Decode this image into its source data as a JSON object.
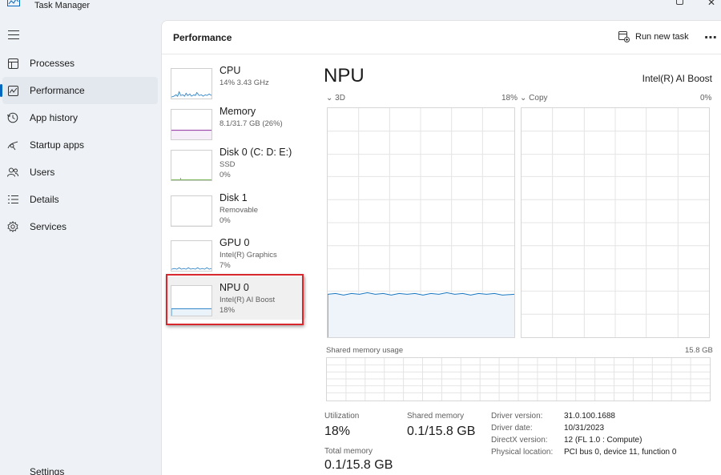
{
  "app": {
    "title": "Task Manager"
  },
  "nav": {
    "items": [
      {
        "label": "Processes",
        "icon": "processes-icon"
      },
      {
        "label": "Performance",
        "icon": "performance-icon",
        "active": true
      },
      {
        "label": "App history",
        "icon": "app-history-icon"
      },
      {
        "label": "Startup apps",
        "icon": "startup-apps-icon"
      },
      {
        "label": "Users",
        "icon": "users-icon"
      },
      {
        "label": "Details",
        "icon": "details-icon"
      },
      {
        "label": "Services",
        "icon": "services-icon"
      }
    ],
    "settings_label": "Settings"
  },
  "header": {
    "title": "Performance",
    "run_task_label": "Run new task",
    "more_label": "⋯"
  },
  "devices": [
    {
      "name": "CPU",
      "sub1": "14%  3.43 GHz",
      "sub2": "",
      "color": "#1a78c2"
    },
    {
      "name": "Memory",
      "sub1": "8.1/31.7 GB (26%)",
      "sub2": "",
      "color": "#8b2c9e"
    },
    {
      "name": "Disk 0 (C: D: E:)",
      "sub1": "SSD",
      "sub2": "0%",
      "color": "#4d9a1f"
    },
    {
      "name": "Disk 1",
      "sub1": "Removable",
      "sub2": "0%",
      "color": "#4d9a1f"
    },
    {
      "name": "GPU 0",
      "sub1": "Intel(R) Graphics",
      "sub2": "7%",
      "color": "#1a78c2"
    },
    {
      "name": "NPU 0",
      "sub1": "Intel(R) AI Boost",
      "sub2": "18%",
      "color": "#1a78c2",
      "selected": true
    }
  ],
  "detail": {
    "title": "NPU",
    "device_name": "Intel(R) AI Boost",
    "graph1": {
      "label": "3D",
      "value": "18%",
      "level": 0.18
    },
    "graph2": {
      "label": "Copy",
      "value": "0%",
      "level": 0
    },
    "shared_memory": {
      "label": "Shared memory usage",
      "value": "15.8 GB"
    },
    "stats": {
      "utilization_label": "Utilization",
      "utilization_value": "18%",
      "shared_label": "Shared memory",
      "shared_value": "0.1/15.8 GB",
      "total_label": "Total memory",
      "total_value": "0.1/15.8 GB"
    },
    "info": {
      "driver_version_label": "Driver version:",
      "driver_version": "31.0.100.1688",
      "driver_date_label": "Driver date:",
      "driver_date": "10/31/2023",
      "directx_label": "DirectX version:",
      "directx": "12 (FL 1.0 : Compute)",
      "location_label": "Physical location:",
      "location": "PCI bus 0, device 11, function 0"
    }
  },
  "colors": {
    "accent": "#0067c0",
    "highlight": "#d9272e",
    "graph_line": "#1a78c2",
    "graph_fill": "#f1f6fb"
  }
}
